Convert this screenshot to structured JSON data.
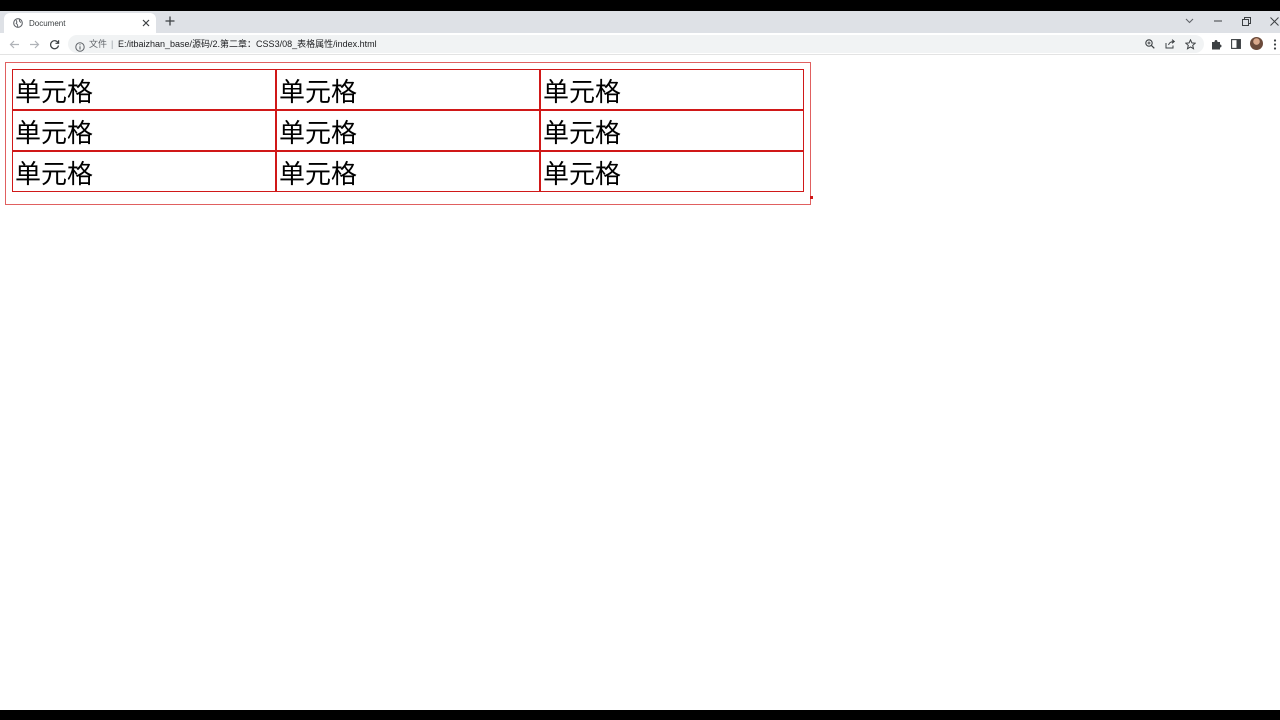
{
  "browser": {
    "tab": {
      "title": "Document"
    },
    "address_bar": {
      "security_label": "文件",
      "separator": "|",
      "url": "E:/itbaizhan_base/源码/2.第二章：CSS3/08_表格属性/index.html"
    }
  },
  "page": {
    "table": {
      "rows": [
        [
          "单元格",
          "单元格",
          "单元格"
        ],
        [
          "单元格",
          "单元格",
          "单元格"
        ],
        [
          "单元格",
          "单元格",
          "单元格"
        ]
      ],
      "border_color": "#d01818"
    }
  },
  "icons": {
    "tab_favicon": "globe-icon",
    "tab_close": "close-icon",
    "new_tab": "plus-icon",
    "back": "back-arrow-icon",
    "forward": "forward-arrow-icon",
    "reload": "reload-icon",
    "info": "info-icon",
    "zoom": "zoom-icon",
    "share": "share-icon",
    "bookmark": "star-icon",
    "extensions": "puzzle-icon",
    "side_panel": "side-panel-icon",
    "menu": "kebab-menu-icon"
  }
}
